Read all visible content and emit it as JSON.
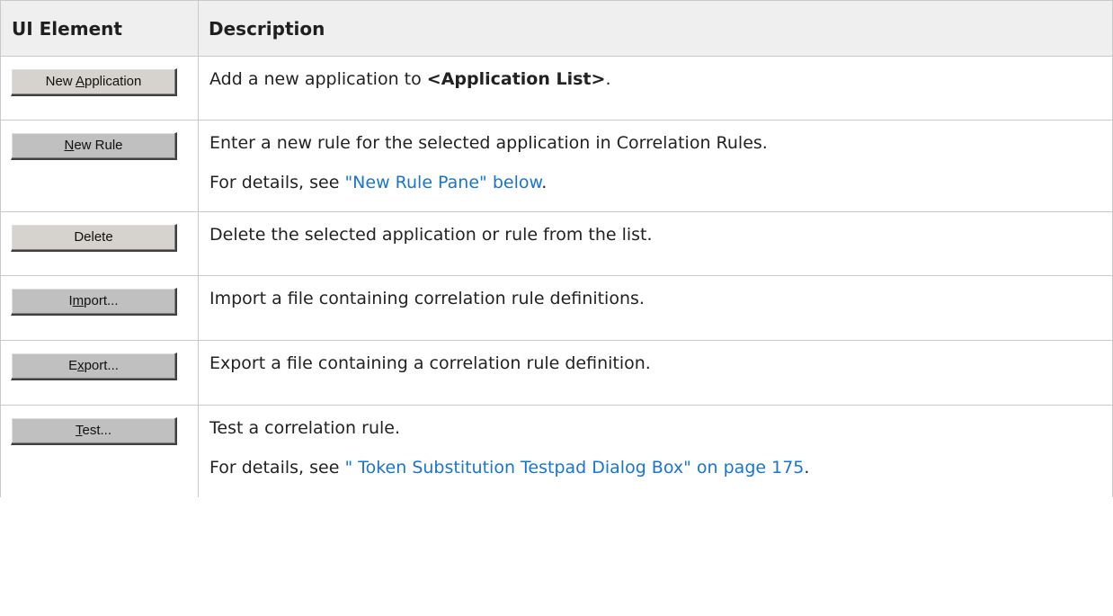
{
  "table": {
    "headers": {
      "ui_element": "UI Element",
      "description": "Description"
    },
    "rows": [
      {
        "button": {
          "before": "New ",
          "mnemonic": "A",
          "after": "pplication"
        },
        "desc_pre": "Add a new application to ",
        "desc_bold": "<Application List>",
        "desc_post": "."
      },
      {
        "button": {
          "before": "",
          "mnemonic": "N",
          "after": "ew Rule"
        },
        "desc": "Enter a new rule for the selected application in Correlation Rules.",
        "details_pre": "For details, see ",
        "details_link": "\"New Rule Pane\" below",
        "details_post": "."
      },
      {
        "button": {
          "before": "Delete",
          "mnemonic": "",
          "after": ""
        },
        "desc": "Delete the selected application or rule from the list."
      },
      {
        "button": {
          "before": "I",
          "mnemonic": "m",
          "after": "port..."
        },
        "desc": "Import a file containing correlation rule definitions."
      },
      {
        "button": {
          "before": "E",
          "mnemonic": "x",
          "after": "port..."
        },
        "desc": "Export a file containing a correlation rule definition."
      },
      {
        "button": {
          "before": "",
          "mnemonic": "T",
          "after": "est..."
        },
        "desc": "Test a correlation rule.",
        "details_pre": "For details, see ",
        "details_link": "\" Token Substitution Testpad Dialog Box\" on page 175",
        "details_post": "."
      }
    ]
  },
  "colors": {
    "link": "#1a75d1",
    "header_bg": "#efefef",
    "button_face": "#c0c0c0"
  }
}
